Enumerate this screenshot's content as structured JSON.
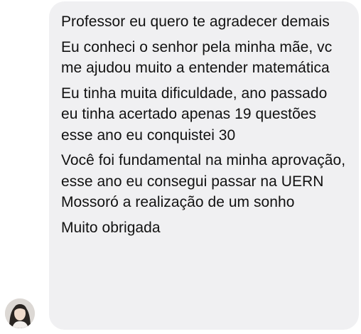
{
  "conversation": {
    "message": {
      "paragraphs": [
        "Professor eu quero te agradecer demais",
        "Eu conheci o senhor pela minha mãe, vc me ajudou muito a entender matemática",
        "Eu tinha muita dificuldade, ano passado eu tinha acertado apenas 19 questões esse ano eu conquistei 30",
        "Você foi fundamental na minha aprovação, esse ano eu consegui passar na UERN Mossoró a realização de um sonho",
        "Muito obrigada"
      ]
    },
    "colors": {
      "bubble_background": "#f0f0f2",
      "text": "#111111"
    }
  }
}
